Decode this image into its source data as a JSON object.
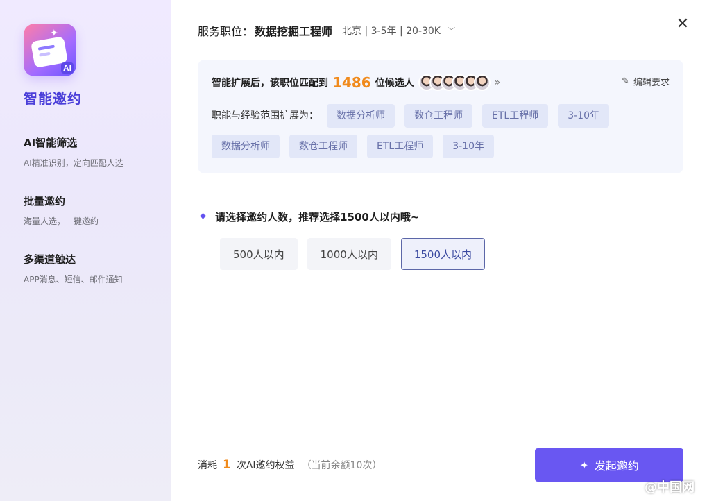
{
  "sidebar": {
    "logo_badge": "AI",
    "brand": "智能邀约",
    "features": [
      {
        "title": "AI智能筛选",
        "desc": "AI精准识别，定向匹配人选"
      },
      {
        "title": "批量邀约",
        "desc": "海量人选，一键邀约"
      },
      {
        "title": "多渠道触达",
        "desc": "APP消息、短信、邮件通知"
      }
    ]
  },
  "header": {
    "label": "服务职位：",
    "job": "数据挖掘工程师",
    "meta": "北京 | 3-5年 | 20-30K",
    "chevron_icon": "chevron-down-icon",
    "close_icon": "close-icon"
  },
  "match": {
    "prefix": "智能扩展后，该职位匹配到",
    "count": "1486",
    "suffix": "位候选人",
    "more_icon": "double-chevron-right-icon",
    "edit_label": "编辑要求",
    "edit_icon": "edit-icon"
  },
  "range": {
    "label": "职能与经验范围扩展为：",
    "tags_row1": [
      "数据分析师",
      "数仓工程师",
      "ETL工程师",
      "3-10年"
    ],
    "tags_row2": [
      "数据分析师",
      "数仓工程师",
      "ETL工程师",
      "3-10年"
    ]
  },
  "select": {
    "title": "请选择邀约人数，推荐选择1500人以内哦~",
    "options": [
      "500人以内",
      "1000人以内",
      "1500人以内"
    ],
    "selected": "1500人以内"
  },
  "footer": {
    "consume_prefix": "消耗",
    "consume_count": "1",
    "consume_suffix": "次AI邀约权益",
    "remaining": "（当前余额10次）",
    "launch_label": "发起邀约"
  },
  "watermark": "@中国网",
  "colors": {
    "accent": "#6957f2",
    "count_orange": "#f08a1c",
    "tag_bg": "#e2e7f8",
    "brand_purple": "#4b3fd9"
  }
}
